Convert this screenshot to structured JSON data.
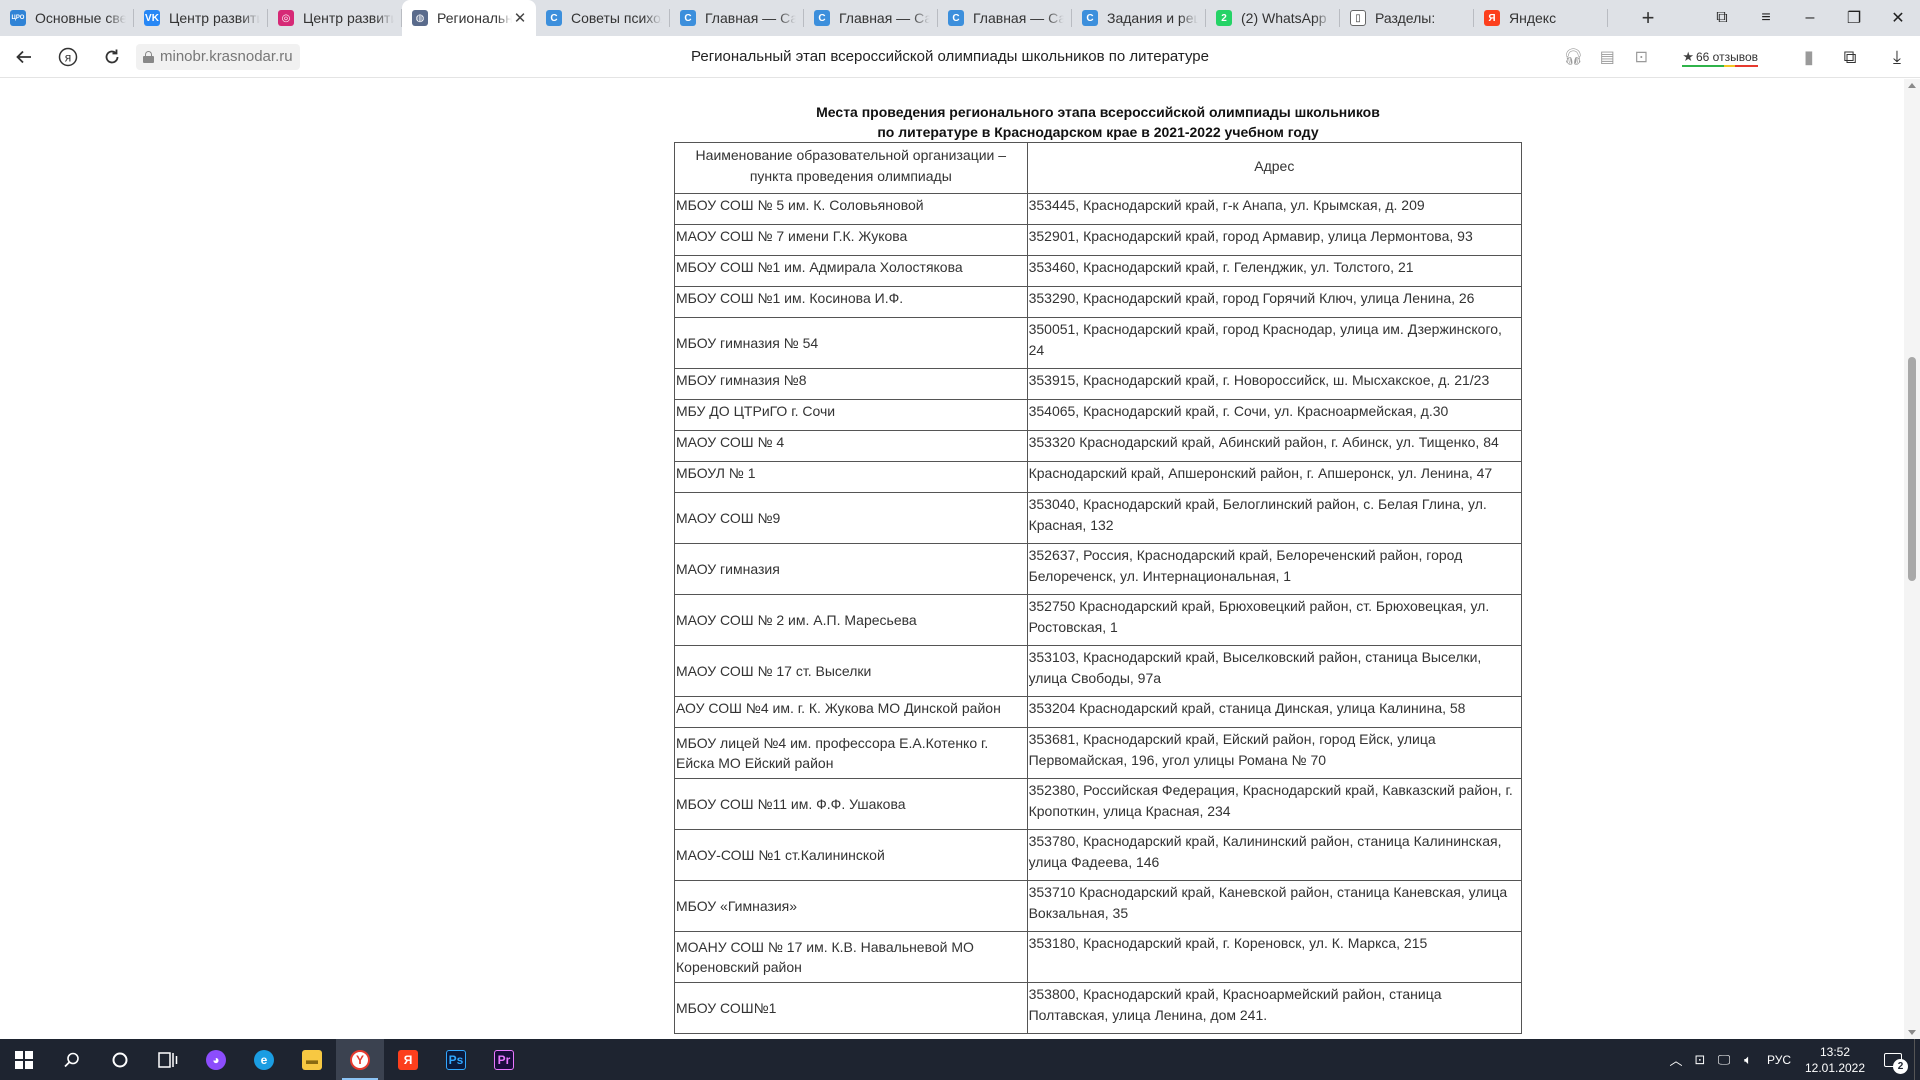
{
  "browser": {
    "tabs": [
      {
        "label": "Основные сведения",
        "icon": "edu-site-icon",
        "icon_color": "#2f83d6",
        "glyph": "ЦРО"
      },
      {
        "label": "Центр развития",
        "icon": "vk-icon",
        "icon_color": "#2787f5",
        "glyph": "VK"
      },
      {
        "label": "Центр развития",
        "icon": "instagram-icon",
        "icon_color": "#d62976",
        "glyph": "◎"
      },
      {
        "label": "Региональный",
        "icon": "globe-icon",
        "icon_color": "#5a6b8c",
        "glyph": "◍",
        "active": true
      },
      {
        "label": "Советы психолога",
        "icon": "site-c-icon",
        "icon_color": "#3c8fdc",
        "glyph": "C"
      },
      {
        "label": "Главная — Сайт",
        "icon": "site-c-icon",
        "icon_color": "#3c8fdc",
        "glyph": "C"
      },
      {
        "label": "Главная — Сайт",
        "icon": "site-c-icon",
        "icon_color": "#3c8fdc",
        "glyph": "C"
      },
      {
        "label": "Главная — Сайт",
        "icon": "site-c-icon",
        "icon_color": "#3c8fdc",
        "glyph": "C"
      },
      {
        "label": "Задания и решения",
        "icon": "site-c-icon",
        "icon_color": "#3c8fdc",
        "glyph": "C"
      },
      {
        "label": "(2) WhatsApp",
        "icon": "whatsapp-icon",
        "icon_color": "#25d366",
        "glyph": "2"
      },
      {
        "label": "Разделы:",
        "icon": "document-icon",
        "icon_color": "#ffffff",
        "glyph": "▯"
      },
      {
        "label": "Яндекс",
        "icon": "yandex-icon",
        "icon_color": "#fc3f1d",
        "glyph": "Я"
      }
    ],
    "close_glyph": "✕",
    "new_tab_glyph": "+",
    "url": "minobr.krasnodar.ru",
    "page_title": "Региональный этап всероссийской олимпиады школьников по литературе",
    "reviews": "66 отзывов",
    "star": "★"
  },
  "page": {
    "heading_line1": "Места проведения регионального этапа всероссийской олимпиады школьников",
    "heading_line2": "по литературе в Краснодарском крае в 2021-2022 учебном году",
    "table": {
      "col1_header": "Наименование образовательной организации – пункта проведения олимпиады",
      "col2_header": "Адрес",
      "rows": [
        {
          "name": "МБОУ СОШ № 5 им. К. Соловьяновой",
          "address": "353445, Краснодарский край, г-к Анапа, ул. Крымская, д. 209"
        },
        {
          "name": "МАОУ СОШ № 7 имени Г.К. Жукова",
          "address": "352901, Краснодарский край, город Армавир, улица Лермонтова, 93"
        },
        {
          "name": "МБОУ СОШ №1 им. Адмирала Холостякова",
          "address": " 353460, Краснодарский край, г. Геленджик, ул. Толстого, 21"
        },
        {
          "name": "МБОУ СОШ №1 им. Косинова И.Ф.",
          "address": "353290, Краснодарский край, город Горячий Ключ, улица Ленина, 26"
        },
        {
          "name": "МБОУ гимназия № 54",
          "address": "350051, Краснодарский край, город Краснодар, улица им. Дзержинского, 24"
        },
        {
          "name": "МБОУ гимназия №8",
          "address": "353915, Краснодарский край, г. Новороссийск, ш. Мысхакское, д. 21/23"
        },
        {
          "name": "МБУ ДО ЦТРиГО г. Сочи",
          "address": "354065, Краснодарский край, г. Сочи, ул. Красноармейская, д.30"
        },
        {
          "name": "МАОУ СОШ № 4",
          "address": "353320 Краснодарский край, Абинский район, г. Абинск, ул. Тищенко, 84"
        },
        {
          "name": "МБОУЛ № 1",
          "address": "Краснодарский край, Апшеронский район, г. Апшеронск, ул. Ленина, 47"
        },
        {
          "name": "МАОУ СОШ №9",
          "address": "353040, Краснодарский край, Белоглинский район, с. Белая Глина, ул. Красная, 132"
        },
        {
          "name": "МАОУ гимназия",
          "address": "352637, Россия, Краснодарский край, Белореченский район, город Белореченск, ул. Интернациональная, 1"
        },
        {
          "name": "МАОУ СОШ № 2 им. А.П. Маресьева",
          "address": "352750 Краснодарский край, Брюховецкий район, ст. Брюховецкая, ул. Ростовская, 1"
        },
        {
          "name": "МАОУ СОШ № 17 ст. Выселки",
          "address": "353103, Краснодарский край, Выселковский район, станица Выселки, улица Свободы, 97а"
        },
        {
          "name": "АОУ СОШ №4 им. г. К. Жукова МО Динской район",
          "address": "353204 Краснодарский край, станица Динская, улица Калинина, 58"
        },
        {
          "name": "МБОУ лицей №4 им. профессора Е.А.Котенко г. Ейска МО Ейский район",
          "address": "353681, Краснодарский край, Ейский район, город Ейск, улица Первомайская, 196, угол улицы Романа № 70"
        },
        {
          "name": "МБОУ СОШ №11 им. Ф.Ф. Ушакова",
          "address": "352380, Российская Федерация, Краснодарский край, Кавказский район, г. Кропоткин, улица Красная, 234"
        },
        {
          "name": "МАОУ-СОШ №1 ст.Калининской",
          "address": "353780, Краснодарский край, Калининский район, станица Калининская, улица Фадеева, 146"
        },
        {
          "name": "МБОУ «Гимназия»",
          "address": "353710 Краснодарский край, Каневской район, станица Каневская, улица Вокзальная, 35"
        },
        {
          "name": "МОАНУ СОШ № 17 им. К.В. Навальневой МО Кореновский район",
          "address": "353180, Краснодарский край, г. Кореновск, ул. К. Маркса, 215"
        },
        {
          "name": "МБОУ СОШ№1",
          "address": "353800, Краснодарский край, Красноармейский район, станица Полтавская, улица Ленина, дом 241."
        }
      ]
    }
  },
  "taskbar": {
    "apps": [
      {
        "name": "alice-icon",
        "color": "#8c4dfc",
        "glyph": "◕"
      },
      {
        "name": "edge-icon",
        "color": "#1b9de2",
        "glyph": "e"
      },
      {
        "name": "file-explorer-icon",
        "color": "#f7c842",
        "glyph": "▬"
      },
      {
        "name": "yandex-browser-icon",
        "color": "#ffffff",
        "glyph": "Y",
        "active": true
      },
      {
        "name": "yandex-icon",
        "color": "#fc3f1d",
        "glyph": "Я"
      },
      {
        "name": "photoshop-icon",
        "color": "#0a1a3c",
        "glyph": "Ps"
      },
      {
        "name": "premiere-icon",
        "color": "#1a0c3c",
        "glyph": "Pr"
      }
    ],
    "lang": "РУС",
    "time": "13:52",
    "date": "12.01.2022",
    "notifications": "2"
  }
}
